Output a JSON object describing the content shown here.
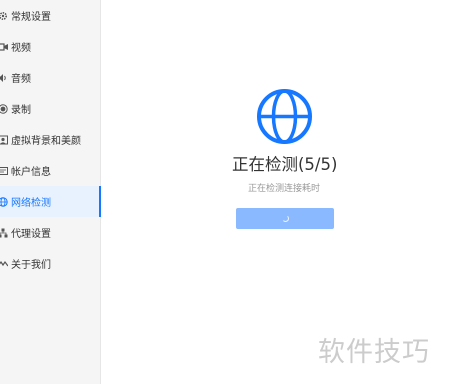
{
  "sidebar": {
    "items": [
      {
        "label": "常规设置",
        "icon": "gear-icon"
      },
      {
        "label": "视频",
        "icon": "video-icon"
      },
      {
        "label": "音频",
        "icon": "speaker-icon"
      },
      {
        "label": "录制",
        "icon": "record-icon"
      },
      {
        "label": "虚拟背景和美颜",
        "icon": "background-icon"
      },
      {
        "label": "帐户信息",
        "icon": "account-icon"
      },
      {
        "label": "网络检测",
        "icon": "globe-icon",
        "active": true
      },
      {
        "label": "代理设置",
        "icon": "proxy-icon"
      },
      {
        "label": "关于我们",
        "icon": "about-icon"
      }
    ]
  },
  "main": {
    "title": "正在检测(5/5)",
    "subtitle": "正在检测连接耗时",
    "accent_color": "#1677ff",
    "button_color": "#8ab9ff"
  },
  "watermark": "软件技巧"
}
